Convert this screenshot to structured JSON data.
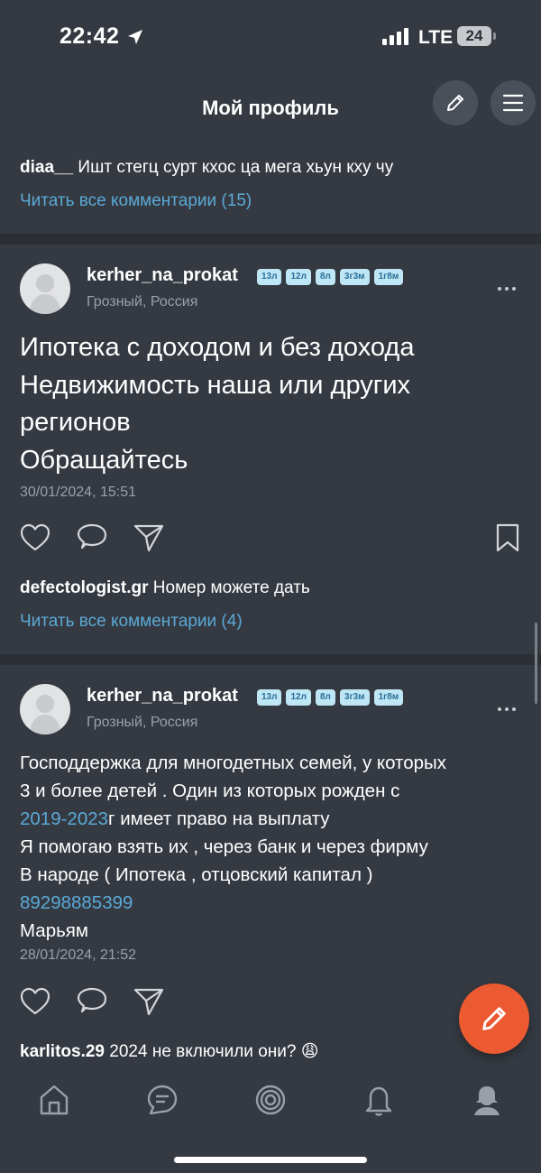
{
  "status": {
    "time": "22:42",
    "network": "LTE",
    "battery": "24"
  },
  "header": {
    "title": "Мой профиль",
    "edit_icon": "pencil-icon",
    "menu_icon": "hamburger-icon"
  },
  "top_comment": {
    "author": "diaa__",
    "text": " Ишт стегц сурт кхос ца мега хьун кху чу",
    "read_all": "Читать все комментарии (15)"
  },
  "posts": [
    {
      "username": "kerher_na_prokat",
      "badges": [
        "13л",
        "12л",
        "8л",
        "3г3м",
        "1г8м"
      ],
      "location": "Грозный, Россия",
      "lines": [
        "Ипотека с доходом и без дохода",
        "Недвижимость наша или других",
        "регионов",
        "Обращайтесь"
      ],
      "date": "30/01/2024, 15:51",
      "comment": {
        "author": "defectologist.gr",
        "text": " Номер можете дать"
      },
      "read_all": "Читать все комментарии (4)"
    },
    {
      "username": "kerher_na_prokat",
      "badges": [
        "13л",
        "12л",
        "8л",
        "3г3м",
        "1г8м"
      ],
      "location": "Грозный, Россия",
      "line1": "Господдержка для многодетных семей, у которых",
      "line2": "3 и более детей . Один из которых рожден с",
      "line3_link": "2019-2023",
      "line3_rest": "г имеет право на выплату",
      "line4": "Я помогаю взять их , через банк и через фирму",
      "line5": "В народе ( Ипотека , отцовский капитал )",
      "phone": "89298885399",
      "line7": "Марьям",
      "date": "28/01/2024, 21:52",
      "comment": {
        "author": "karlitos.29",
        "text": " 2024 не включили они? 😩"
      }
    }
  ],
  "colors": {
    "background": "#353a42",
    "link": "#5aa9d6",
    "fab": "#ec5a32",
    "badge_bg": "#bfe6f4"
  },
  "tabbar": {
    "items": [
      "home-icon",
      "messages-icon",
      "target-icon",
      "notifications-bell-icon",
      "profile-icon"
    ]
  }
}
